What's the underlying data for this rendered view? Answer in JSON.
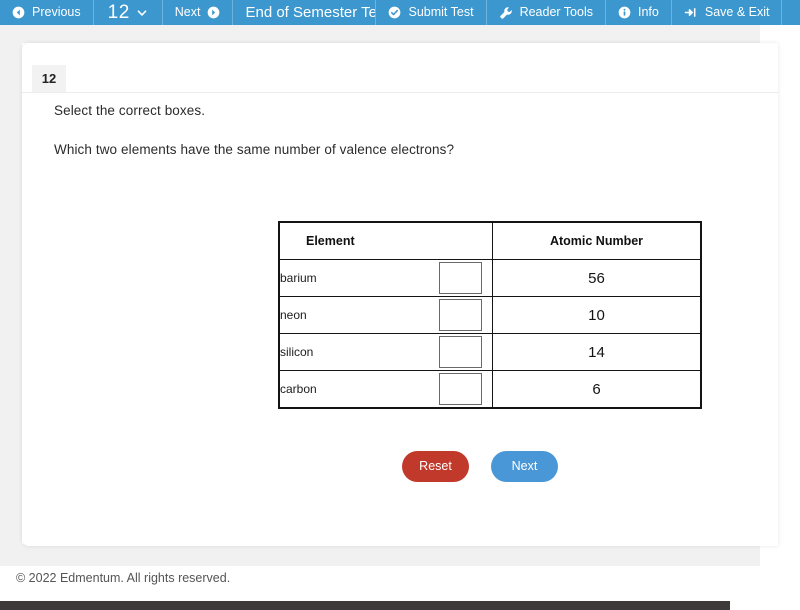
{
  "toolbar": {
    "previous_label": "Previous",
    "page_number": "12",
    "next_label": "Next",
    "assessment_title": "End of Semester Test",
    "submit_label": "Submit Test",
    "reader_tools_label": "Reader Tools",
    "info_label": "Info",
    "save_exit_label": "Save & Exit",
    "background_color": "#3b97ce"
  },
  "question": {
    "number": "12",
    "instruction": "Select the correct boxes.",
    "prompt": "Which two elements have the same number of valence electrons?"
  },
  "table": {
    "headers": [
      "Element",
      "Atomic Number"
    ],
    "rows": [
      {
        "element": "barium",
        "atomic_number": "56",
        "selected": false
      },
      {
        "element": "neon",
        "atomic_number": "10",
        "selected": false
      },
      {
        "element": "silicon",
        "atomic_number": "14",
        "selected": false
      },
      {
        "element": "carbon",
        "atomic_number": "6",
        "selected": false
      }
    ]
  },
  "actions": {
    "reset_label": "Reset",
    "next_label": "Next",
    "reset_color": "#c0392b",
    "next_color": "#4a97d7"
  },
  "footer": {
    "copyright": "© 2022 Edmentum. All rights reserved."
  }
}
